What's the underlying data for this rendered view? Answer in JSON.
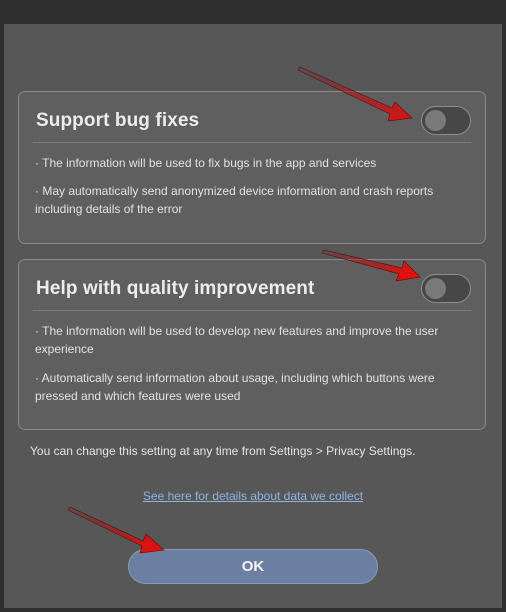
{
  "sections": [
    {
      "title": "Support bug fixes",
      "toggle_on": false,
      "bullets": [
        "· The information will be used to fix bugs in the app and services",
        "· May automatically send anonymized device information and crash reports including details of the error"
      ]
    },
    {
      "title": "Help with quality improvement",
      "toggle_on": false,
      "bullets": [
        "· The information will be used to develop new features and improve the user experience",
        "· Automatically send information about usage, including which buttons were pressed and which features were used"
      ]
    }
  ],
  "note": "You can change this setting at any time from Settings > Privacy Settings.",
  "link_text": "See here for details about data we collect",
  "ok_label": "OK",
  "colors": {
    "background": "#575757",
    "card": "#5f5f5f",
    "button": "#6b7fa3",
    "link": "#8fb3e0",
    "annotation_arrow": "#e01010"
  }
}
